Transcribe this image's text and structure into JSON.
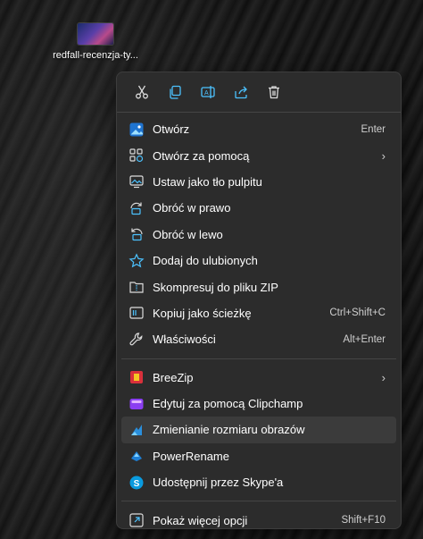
{
  "desktop": {
    "file_label": "redfall-recenzja-ty..."
  },
  "quick_actions": [
    {
      "icon": "cut-icon"
    },
    {
      "icon": "copy-icon"
    },
    {
      "icon": "rename-icon"
    },
    {
      "icon": "share-icon"
    },
    {
      "icon": "delete-icon"
    }
  ],
  "menu": {
    "open": {
      "label": "Otwórz",
      "shortcut": "Enter"
    },
    "open_with": {
      "label": "Otwórz za pomocą"
    },
    "set_wallpaper": {
      "label": "Ustaw jako tło pulpitu"
    },
    "rotate_right": {
      "label": "Obróć w prawo"
    },
    "rotate_left": {
      "label": "Obróć w lewo"
    },
    "add_favorites": {
      "label": "Dodaj do ulubionych"
    },
    "compress_zip": {
      "label": "Skompresuj do pliku ZIP"
    },
    "copy_path": {
      "label": "Kopiuj jako ścieżkę",
      "shortcut": "Ctrl+Shift+C"
    },
    "properties": {
      "label": "Właściwości",
      "shortcut": "Alt+Enter"
    },
    "breezip": {
      "label": "BreeZip"
    },
    "clipchamp": {
      "label": "Edytuj za pomocą Clipchamp"
    },
    "resize": {
      "label": "Zmienianie rozmiaru obrazów"
    },
    "powerrename": {
      "label": "PowerRename"
    },
    "skype": {
      "label": "Udostępnij przez Skype'a"
    },
    "more_options": {
      "label": "Pokaż więcej opcji",
      "shortcut": "Shift+F10"
    }
  },
  "colors": {
    "accent": "#4cc2ff",
    "menu_bg": "#2c2c2c",
    "highlight": "#3b3b3b"
  }
}
